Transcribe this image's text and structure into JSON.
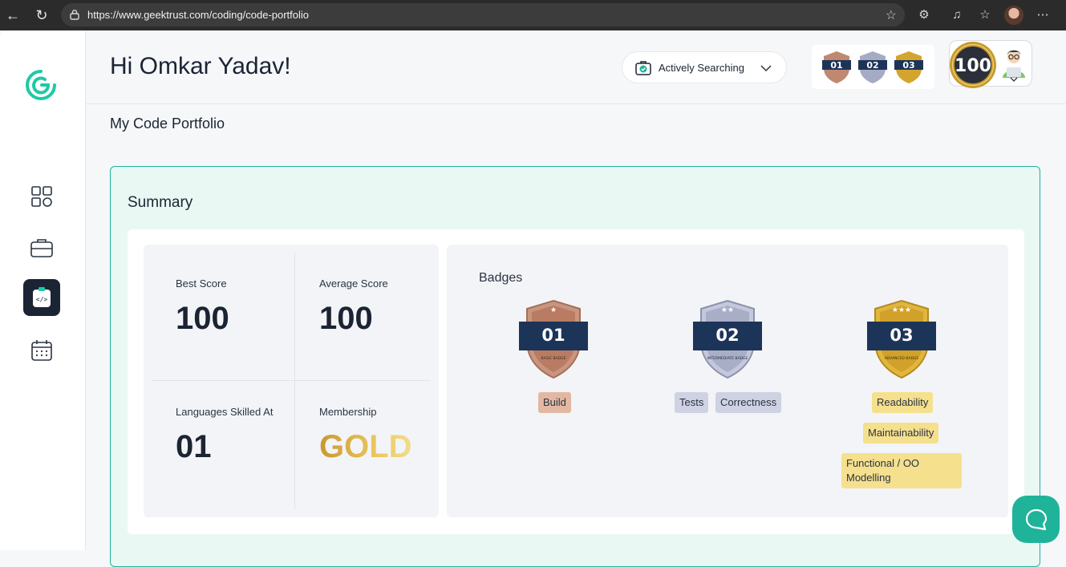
{
  "browser": {
    "url": "https://www.geektrust.com/coding/code-portfolio"
  },
  "header": {
    "greeting": "Hi Omkar Yadav!",
    "status": "Actively Searching",
    "strip_badges": [
      "01",
      "02",
      "03"
    ],
    "score_medal": "100"
  },
  "page": {
    "title": "My Code Portfolio"
  },
  "summary": {
    "title": "Summary",
    "stats": {
      "best_score": {
        "label": "Best Score",
        "value": "100"
      },
      "average_score": {
        "label": "Average Score",
        "value": "100"
      },
      "languages": {
        "label": "Languages Skilled At",
        "value": "01"
      },
      "membership": {
        "label": "Membership",
        "value": "GOLD"
      }
    },
    "badges_title": "Badges",
    "badges": [
      {
        "number": "01",
        "name": "BASIC BADGE",
        "tags": [
          "Build"
        ],
        "color": "#c08870"
      },
      {
        "number": "02",
        "name": "INTERMEDIATE BADGE",
        "tags": [
          "Tests",
          "Correctness"
        ],
        "color": "#a6abc4"
      },
      {
        "number": "03",
        "name": "ADVANCED BADGE",
        "tags": [
          "Readability",
          "Maintainability",
          "Functional / OO Modelling"
        ],
        "color": "#d4a52c"
      }
    ]
  },
  "colors": {
    "accent": "#1fb39a",
    "dark": "#1b2433",
    "summary_bg": "#e9f8f3"
  }
}
